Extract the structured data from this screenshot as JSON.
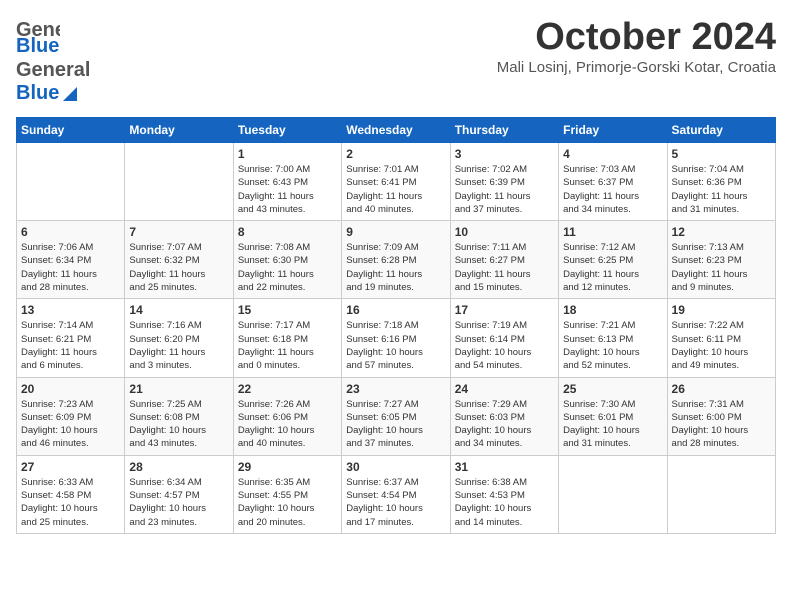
{
  "logo": {
    "general": "General",
    "blue": "Blue"
  },
  "title": "October 2024",
  "location": "Mali Losinj, Primorje-Gorski Kotar, Croatia",
  "days_of_week": [
    "Sunday",
    "Monday",
    "Tuesday",
    "Wednesday",
    "Thursday",
    "Friday",
    "Saturday"
  ],
  "weeks": [
    [
      {
        "num": "",
        "info": ""
      },
      {
        "num": "",
        "info": ""
      },
      {
        "num": "1",
        "info": "Sunrise: 7:00 AM\nSunset: 6:43 PM\nDaylight: 11 hours\nand 43 minutes."
      },
      {
        "num": "2",
        "info": "Sunrise: 7:01 AM\nSunset: 6:41 PM\nDaylight: 11 hours\nand 40 minutes."
      },
      {
        "num": "3",
        "info": "Sunrise: 7:02 AM\nSunset: 6:39 PM\nDaylight: 11 hours\nand 37 minutes."
      },
      {
        "num": "4",
        "info": "Sunrise: 7:03 AM\nSunset: 6:37 PM\nDaylight: 11 hours\nand 34 minutes."
      },
      {
        "num": "5",
        "info": "Sunrise: 7:04 AM\nSunset: 6:36 PM\nDaylight: 11 hours\nand 31 minutes."
      }
    ],
    [
      {
        "num": "6",
        "info": "Sunrise: 7:06 AM\nSunset: 6:34 PM\nDaylight: 11 hours\nand 28 minutes."
      },
      {
        "num": "7",
        "info": "Sunrise: 7:07 AM\nSunset: 6:32 PM\nDaylight: 11 hours\nand 25 minutes."
      },
      {
        "num": "8",
        "info": "Sunrise: 7:08 AM\nSunset: 6:30 PM\nDaylight: 11 hours\nand 22 minutes."
      },
      {
        "num": "9",
        "info": "Sunrise: 7:09 AM\nSunset: 6:28 PM\nDaylight: 11 hours\nand 19 minutes."
      },
      {
        "num": "10",
        "info": "Sunrise: 7:11 AM\nSunset: 6:27 PM\nDaylight: 11 hours\nand 15 minutes."
      },
      {
        "num": "11",
        "info": "Sunrise: 7:12 AM\nSunset: 6:25 PM\nDaylight: 11 hours\nand 12 minutes."
      },
      {
        "num": "12",
        "info": "Sunrise: 7:13 AM\nSunset: 6:23 PM\nDaylight: 11 hours\nand 9 minutes."
      }
    ],
    [
      {
        "num": "13",
        "info": "Sunrise: 7:14 AM\nSunset: 6:21 PM\nDaylight: 11 hours\nand 6 minutes."
      },
      {
        "num": "14",
        "info": "Sunrise: 7:16 AM\nSunset: 6:20 PM\nDaylight: 11 hours\nand 3 minutes."
      },
      {
        "num": "15",
        "info": "Sunrise: 7:17 AM\nSunset: 6:18 PM\nDaylight: 11 hours\nand 0 minutes."
      },
      {
        "num": "16",
        "info": "Sunrise: 7:18 AM\nSunset: 6:16 PM\nDaylight: 10 hours\nand 57 minutes."
      },
      {
        "num": "17",
        "info": "Sunrise: 7:19 AM\nSunset: 6:14 PM\nDaylight: 10 hours\nand 54 minutes."
      },
      {
        "num": "18",
        "info": "Sunrise: 7:21 AM\nSunset: 6:13 PM\nDaylight: 10 hours\nand 52 minutes."
      },
      {
        "num": "19",
        "info": "Sunrise: 7:22 AM\nSunset: 6:11 PM\nDaylight: 10 hours\nand 49 minutes."
      }
    ],
    [
      {
        "num": "20",
        "info": "Sunrise: 7:23 AM\nSunset: 6:09 PM\nDaylight: 10 hours\nand 46 minutes."
      },
      {
        "num": "21",
        "info": "Sunrise: 7:25 AM\nSunset: 6:08 PM\nDaylight: 10 hours\nand 43 minutes."
      },
      {
        "num": "22",
        "info": "Sunrise: 7:26 AM\nSunset: 6:06 PM\nDaylight: 10 hours\nand 40 minutes."
      },
      {
        "num": "23",
        "info": "Sunrise: 7:27 AM\nSunset: 6:05 PM\nDaylight: 10 hours\nand 37 minutes."
      },
      {
        "num": "24",
        "info": "Sunrise: 7:29 AM\nSunset: 6:03 PM\nDaylight: 10 hours\nand 34 minutes."
      },
      {
        "num": "25",
        "info": "Sunrise: 7:30 AM\nSunset: 6:01 PM\nDaylight: 10 hours\nand 31 minutes."
      },
      {
        "num": "26",
        "info": "Sunrise: 7:31 AM\nSunset: 6:00 PM\nDaylight: 10 hours\nand 28 minutes."
      }
    ],
    [
      {
        "num": "27",
        "info": "Sunrise: 6:33 AM\nSunset: 4:58 PM\nDaylight: 10 hours\nand 25 minutes."
      },
      {
        "num": "28",
        "info": "Sunrise: 6:34 AM\nSunset: 4:57 PM\nDaylight: 10 hours\nand 23 minutes."
      },
      {
        "num": "29",
        "info": "Sunrise: 6:35 AM\nSunset: 4:55 PM\nDaylight: 10 hours\nand 20 minutes."
      },
      {
        "num": "30",
        "info": "Sunrise: 6:37 AM\nSunset: 4:54 PM\nDaylight: 10 hours\nand 17 minutes."
      },
      {
        "num": "31",
        "info": "Sunrise: 6:38 AM\nSunset: 4:53 PM\nDaylight: 10 hours\nand 14 minutes."
      },
      {
        "num": "",
        "info": ""
      },
      {
        "num": "",
        "info": ""
      }
    ]
  ]
}
